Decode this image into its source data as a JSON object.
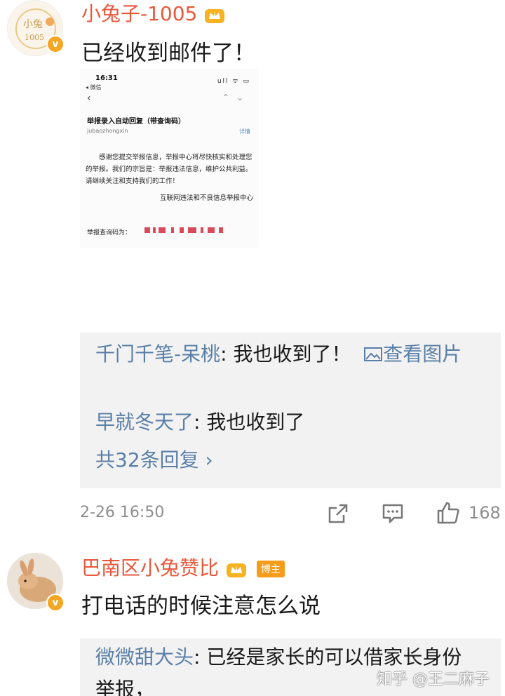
{
  "comments": [
    {
      "username": "小兔子-1005",
      "text": "已经收到邮件了！",
      "attachment": {
        "time": "16:31",
        "back_label": "◂ 微信",
        "status_icons": "ull ᯤ ▭",
        "subject": "举报录入自动回复（带查询码）",
        "sender": "jubaozhongxin",
        "detail_link": "详情",
        "body": "感谢您提交举报信息，举报中心将尽快核实和处理您的举报。我们的宗旨是：举报违法信息，维护公共利益。请继续关注和支持我们的工作！",
        "signature": "互联网违法和不良信息举报中心",
        "code_label": "举报查询码为："
      },
      "replies": [
        {
          "name": "千门千笔-呆桃",
          "text": ": 我也收到了！",
          "extra": "查看图片"
        },
        {
          "name": "早就冬天了",
          "text": ": 我也收到了"
        }
      ],
      "more_replies": "共32条回复 ›",
      "time": "2-26 16:50",
      "likes": "168"
    },
    {
      "username": "巴南区小兔赞比",
      "badge": "博主",
      "text": "打电话的时候注意怎么说",
      "replies": [
        {
          "name": "微微甜大头",
          "text": ": 已经是家长的可以借家长身份举报，"
        }
      ]
    }
  ],
  "watermark": "知乎 @王二麻子",
  "colors": {
    "username": "#e8573c",
    "reply_name": "#5a7fa8",
    "badge": "#f59c1a",
    "reply_bg": "#f2f2f2"
  }
}
